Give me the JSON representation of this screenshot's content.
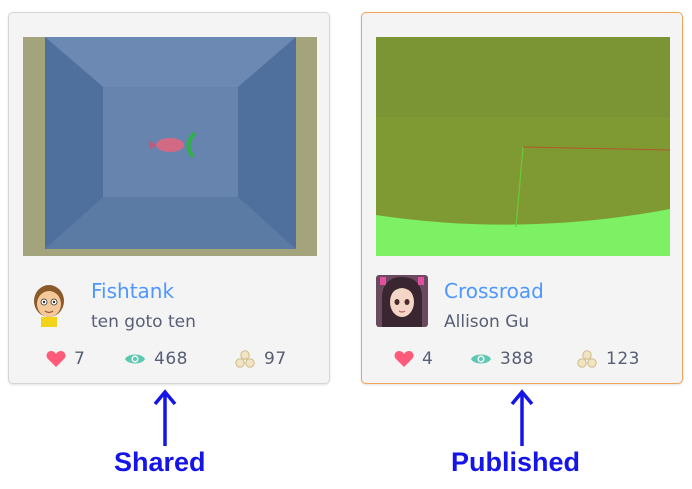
{
  "cards": [
    {
      "title": "Fishtank",
      "author": "ten goto ten",
      "loves": "7",
      "views": "468",
      "remixes": "97",
      "caption": "Shared",
      "border_color": "#d6d6d6"
    },
    {
      "title": "Crossroad",
      "author": "Allison Gu",
      "loves": "4",
      "views": "388",
      "remixes": "123",
      "caption": "Published",
      "border_color": "#f0a35a"
    }
  ],
  "icons": {
    "love": "heart-icon",
    "views": "eye-icon",
    "remixes": "remix-icon",
    "arrow": "up-arrow-icon"
  },
  "colors": {
    "title": "#4d97ff",
    "text": "#575e75",
    "heart": "#ff5a79",
    "eye": "#5cc8b2",
    "caption": "#1515e8"
  }
}
